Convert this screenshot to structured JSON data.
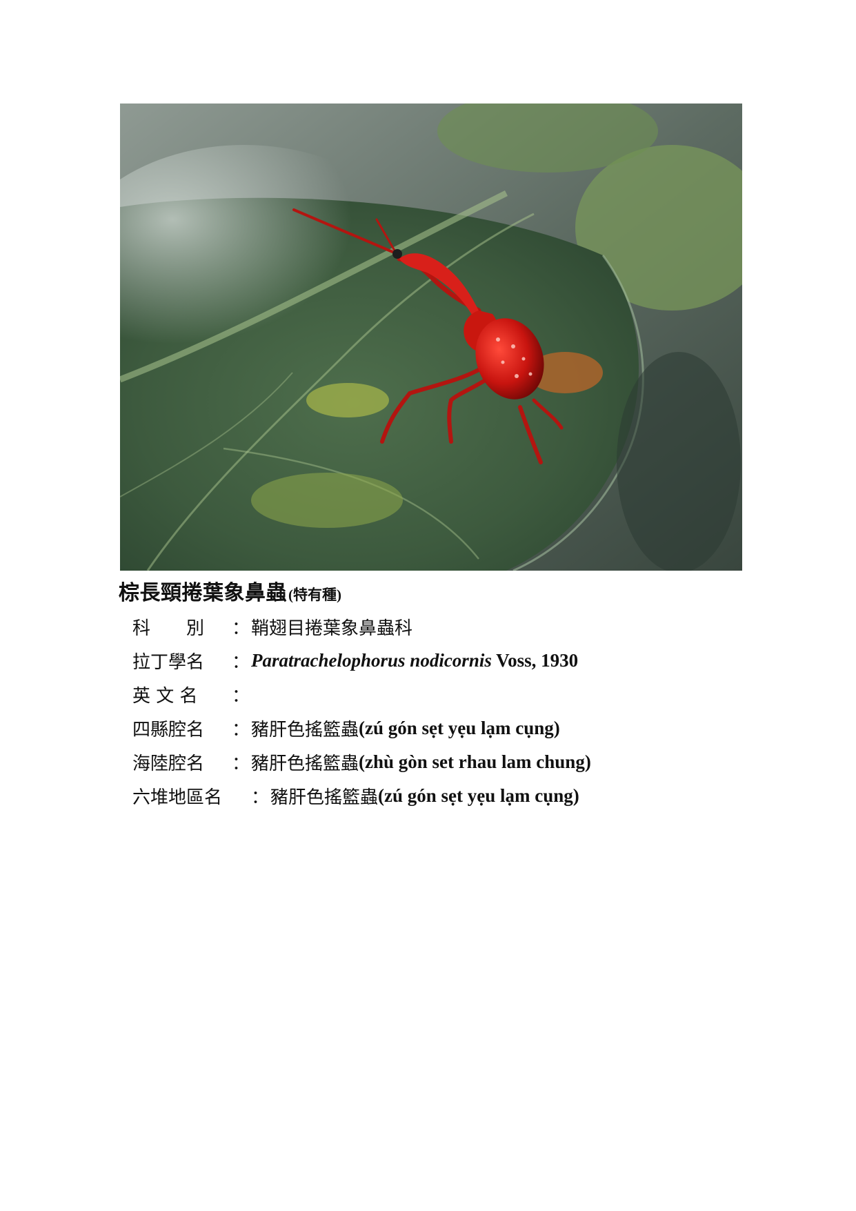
{
  "species": {
    "common_name": "棕長頸捲葉象鼻蟲",
    "note": "(特有種)"
  },
  "fields": [
    {
      "label": "科　　別",
      "value": "鞘翅目捲葉象鼻蟲科"
    },
    {
      "label": "拉丁學名",
      "latin_italic": "Paratrachelophorus nodicornis",
      "latin_author": " Voss, 1930"
    },
    {
      "label": "英 文 名",
      "value": ""
    },
    {
      "label": "四縣腔名",
      "value": "豬肝色搖籃蟲",
      "romanization": "(zú gón sẹt yẹu lạm cụng)"
    },
    {
      "label": "海陸腔名",
      "value": "豬肝色搖籃蟲",
      "romanization": "(zhù gòn set rhau lam chung)"
    },
    {
      "label": "六堆地區名",
      "value": "豬肝色搖籃蟲",
      "romanization": "(zú gón sẹt yẹu lạm cụng)"
    }
  ],
  "colon": "："
}
